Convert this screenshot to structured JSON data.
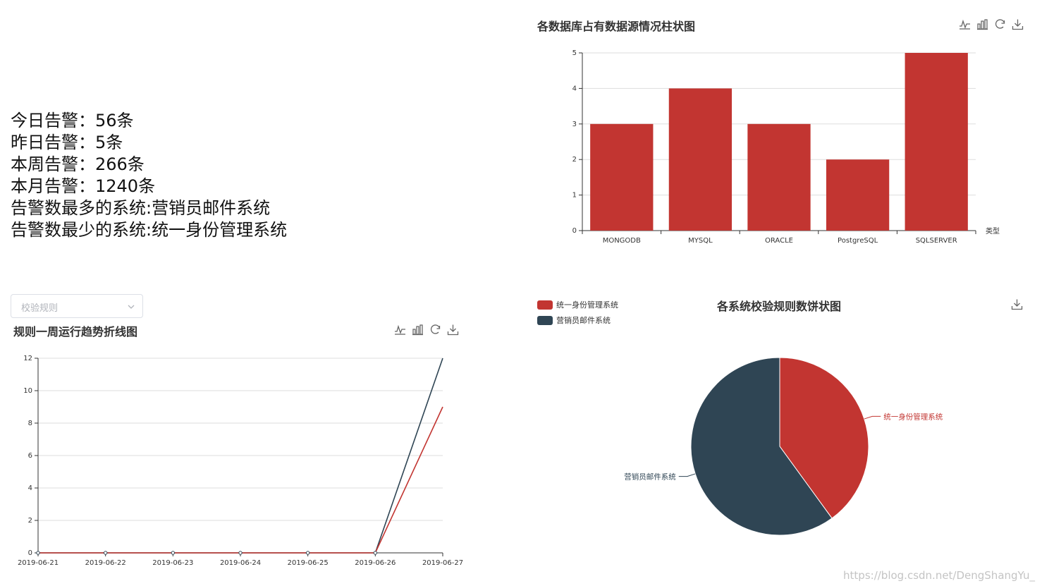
{
  "stats": [
    "今日告警：56条",
    "昨日告警：5条",
    "本周告警：266条",
    "本月告警：1240条",
    "告警数最多的系统:营销员邮件系统",
    "告警数最少的系统:统一身份管理系统"
  ],
  "select": {
    "placeholder": "校验规则"
  },
  "colors": {
    "red": "#c23531",
    "navy": "#2f4554",
    "axis": "#333333",
    "grid": "#dddddd"
  },
  "toolbox_icons": [
    "line-chart-icon",
    "bar-chart-icon",
    "refresh-icon",
    "download-icon"
  ],
  "watermark": "https://blog.csdn.net/DengShangYu_",
  "chart_data": [
    {
      "type": "bar",
      "title": "各数据库占有数据源情况柱状图",
      "categories": [
        "MONGODB",
        "MYSQL",
        "ORACLE",
        "PostgreSQL",
        "SQLSERVER"
      ],
      "values": [
        3,
        4,
        3,
        2,
        5
      ],
      "xlabel": "类型",
      "ylabel": "",
      "ylim": [
        0,
        5
      ],
      "yticks": [
        0,
        1,
        2,
        3,
        4,
        5
      ],
      "grid": true
    },
    {
      "type": "line",
      "title": "规则一周运行趋势折线图",
      "categories": [
        "2019-06-21",
        "2019-06-22",
        "2019-06-23",
        "2019-06-24",
        "2019-06-25",
        "2019-06-26",
        "2019-06-27"
      ],
      "series": [
        {
          "values": [
            0,
            0,
            0,
            0,
            0,
            0,
            12
          ]
        },
        {
          "values": [
            0,
            0,
            0,
            0,
            0,
            0,
            9
          ]
        }
      ],
      "ylim": [
        0,
        12
      ],
      "yticks": [
        0,
        2,
        4,
        6,
        8,
        10,
        12
      ],
      "grid": true
    },
    {
      "type": "pie",
      "title": "各系统校验规则数饼状图",
      "slices": [
        {
          "name": "统一身份管理系统",
          "value": 2
        },
        {
          "name": "营销员邮件系统",
          "value": 3
        }
      ],
      "legend": "top-left"
    }
  ]
}
